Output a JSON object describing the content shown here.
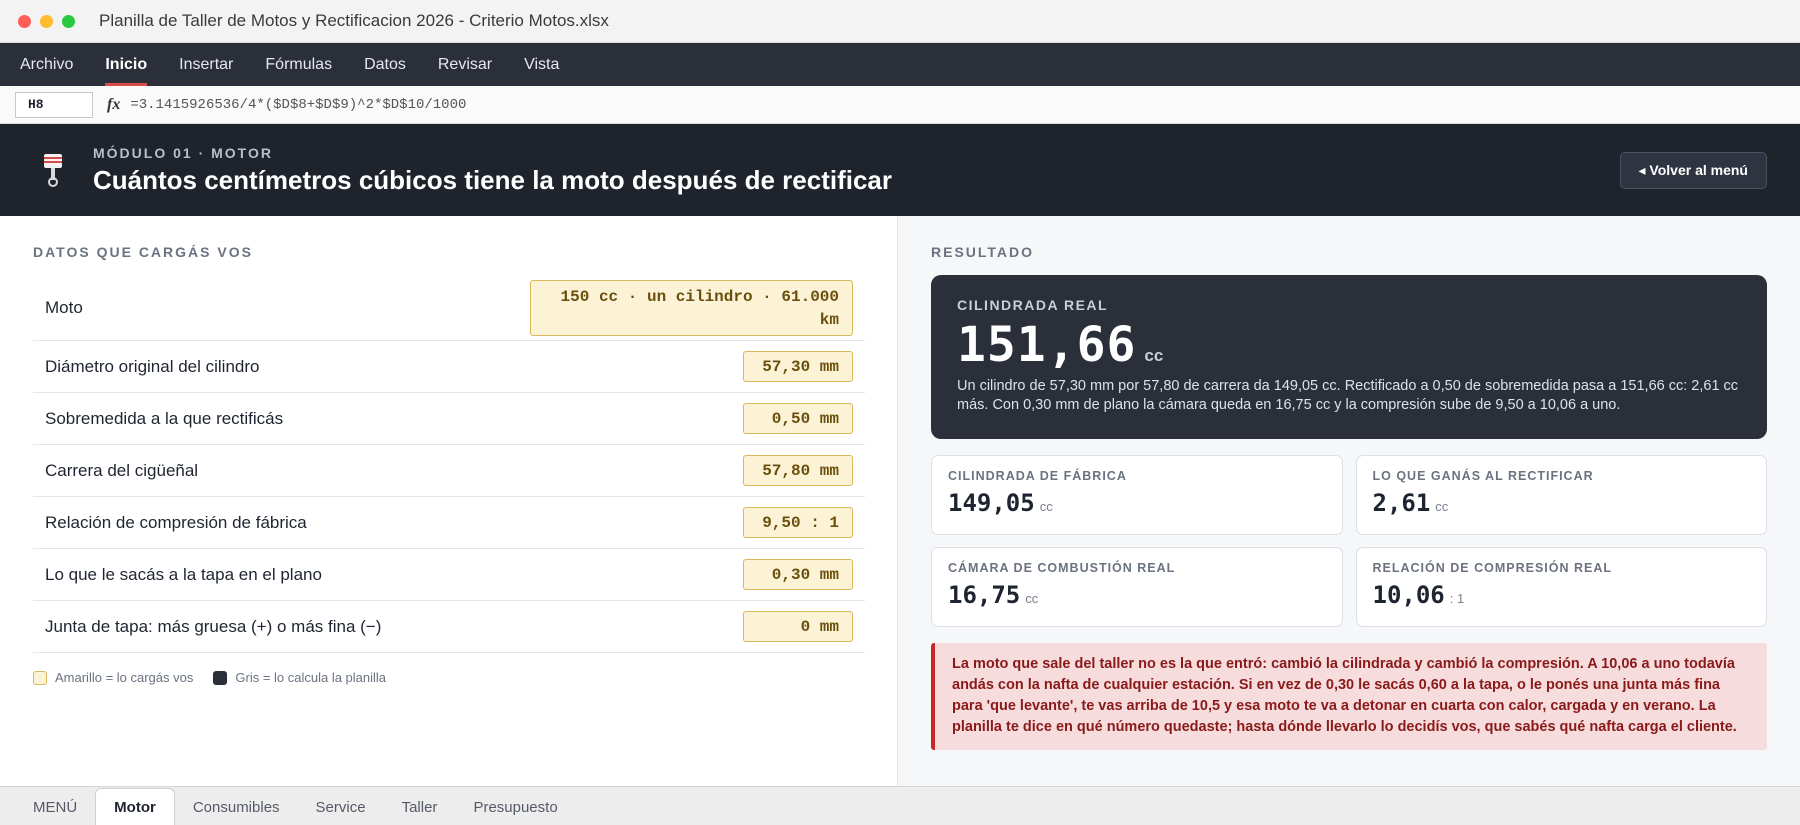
{
  "window": {
    "title": "Planilla de Taller de Motos y Rectificacion 2026 - Criterio Motos.xlsx"
  },
  "menu": {
    "items": [
      {
        "label": "Archivo",
        "active": false
      },
      {
        "label": "Inicio",
        "active": true
      },
      {
        "label": "Insertar",
        "active": false
      },
      {
        "label": "Fórmulas",
        "active": false
      },
      {
        "label": "Datos",
        "active": false
      },
      {
        "label": "Revisar",
        "active": false
      },
      {
        "label": "Vista",
        "active": false
      }
    ]
  },
  "formula_bar": {
    "cell": "H8",
    "fx": "fx",
    "formula": "=3.1415926536/4*($D$8+$D$9)^2*$D$10/1000"
  },
  "header": {
    "icon": "piston-icon",
    "subtitle": "MÓDULO 01 · MOTOR",
    "title": "Cuántos centímetros cúbicos tiene la moto después de rectificar",
    "back_label": "◂ Volver al menú"
  },
  "inputs": {
    "section_label": "DATOS QUE CARGÁS VOS",
    "rows": [
      {
        "label": "Moto",
        "value": "150 cc · un cilindro · 61.000 km"
      },
      {
        "label": "Diámetro original del cilindro",
        "value": "57,30 mm"
      },
      {
        "label": "Sobremedida a la que rectificás",
        "value": "0,50 mm"
      },
      {
        "label": "Carrera del cigüeñal",
        "value": "57,80 mm"
      },
      {
        "label": "Relación de compresión de fábrica",
        "value": "9,50 : 1"
      },
      {
        "label": "Lo que le sacás a la tapa en el plano",
        "value": "0,30 mm"
      },
      {
        "label": "Junta de tapa: más gruesa (+) o más fina (−)",
        "value": "0 mm"
      }
    ],
    "legend": {
      "yellow": "Amarillo = lo cargás vos",
      "gray": "Gris = lo calcula la planilla"
    }
  },
  "result": {
    "section_label": "RESULTADO",
    "main": {
      "label": "CILINDRADA REAL",
      "value": "151,66",
      "unit": "cc",
      "description": "Un cilindro de 57,30 mm por 57,80 de carrera da 149,05 cc. Rectificado a 0,50 de sobremedida pasa a 151,66 cc: 2,61 cc más. Con 0,30 mm de plano la cámara queda en 16,75 cc y la compresión sube de 9,50 a 10,06 a uno."
    },
    "kpis": [
      {
        "label": "CILINDRADA DE FÁBRICA",
        "value": "149,05",
        "unit": "cc"
      },
      {
        "label": "LO QUE GANÁS AL RECTIFICAR",
        "value": "2,61",
        "unit": "cc"
      },
      {
        "label": "CÁMARA DE COMBUSTIÓN REAL",
        "value": "16,75",
        "unit": "cc"
      },
      {
        "label": "RELACIÓN DE COMPRESIÓN REAL",
        "value": "10,06",
        "unit": ": 1"
      }
    ],
    "warning": "La moto que sale del taller no es la que entró: cambió la cilindrada y cambió la compresión. A 10,06 a uno todavía andás con la nafta de cualquier estación. Si en vez de 0,30 le sacás 0,60 a la tapa, o le ponés una junta más fina para 'que levante', te vas arriba de 10,5 y esa moto te va a detonar en cuarta con calor, cargada y en verano. La planilla te dice en qué número quedaste; hasta dónde llevarlo lo decidís vos, que sabés qué nafta carga el cliente."
  },
  "sheet_tabs": [
    {
      "label": "MENÚ",
      "active": false
    },
    {
      "label": "Motor",
      "active": true
    },
    {
      "label": "Consumibles",
      "active": false
    },
    {
      "label": "Service",
      "active": false
    },
    {
      "label": "Taller",
      "active": false
    },
    {
      "label": "Presupuesto",
      "active": false
    }
  ],
  "colors": {
    "accent_red": "#d94b4b",
    "dark_panel": "#2a2f3a",
    "input_fill": "#fcf3d6",
    "warning_bg": "#f6dcdc"
  }
}
